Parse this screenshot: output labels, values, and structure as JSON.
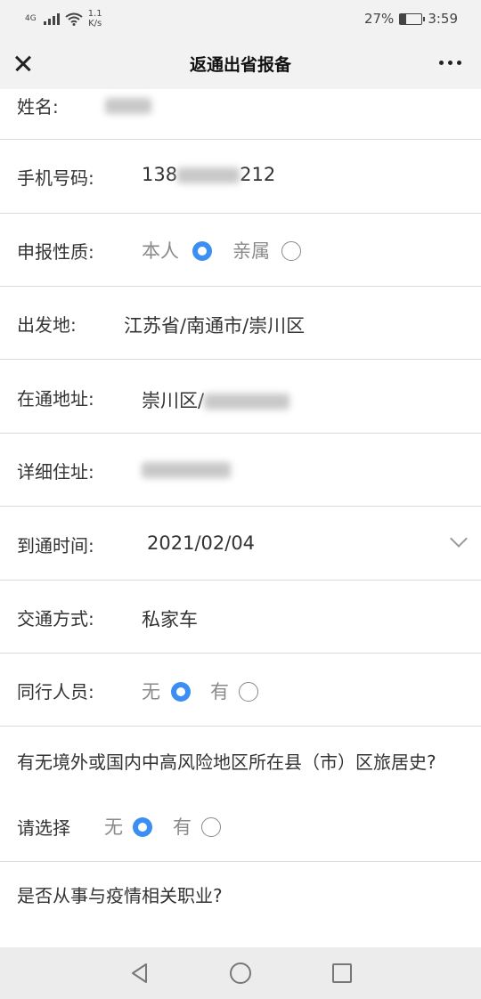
{
  "status_bar": {
    "network": "4G",
    "speed_value": "1.1",
    "speed_unit": "K/s",
    "battery_percent": "27%",
    "battery_level": 0.27,
    "time": "3:59"
  },
  "header": {
    "title": "返通出省报备",
    "close_icon": "close-icon",
    "more_icon": "more-icon"
  },
  "form": {
    "name_label": "姓名:",
    "phone_label": "手机号码:",
    "phone_prefix": "138",
    "phone_suffix": "212",
    "type_label": "申报性质:",
    "type_option_self": "本人",
    "type_option_relative": "亲属",
    "type_selected": "本人",
    "origin_label": "出发地:",
    "origin_value": "江苏省/南通市/崇川区",
    "address_label": "在通地址:",
    "address_prefix": "崇川区/",
    "detail_label": "详细住址:",
    "arrival_label": "到通时间:",
    "arrival_value": "2021/02/04",
    "transport_label": "交通方式:",
    "transport_value": "私家车",
    "companion_label": "同行人员:",
    "companion_option_no": "无",
    "companion_option_yes": "有",
    "companion_selected": "无",
    "risk_question": "有无境外或国内中高风险地区所在县（市）区旅居史?",
    "risk_select_label": "请选择",
    "risk_option_no": "无",
    "risk_option_yes": "有",
    "risk_selected": "无",
    "job_question": "是否从事与疫情相关职业?"
  },
  "colors": {
    "accent": "#3b8ff3",
    "divider": "#d9d9d9",
    "bar_bg": "#f2f2f2"
  }
}
